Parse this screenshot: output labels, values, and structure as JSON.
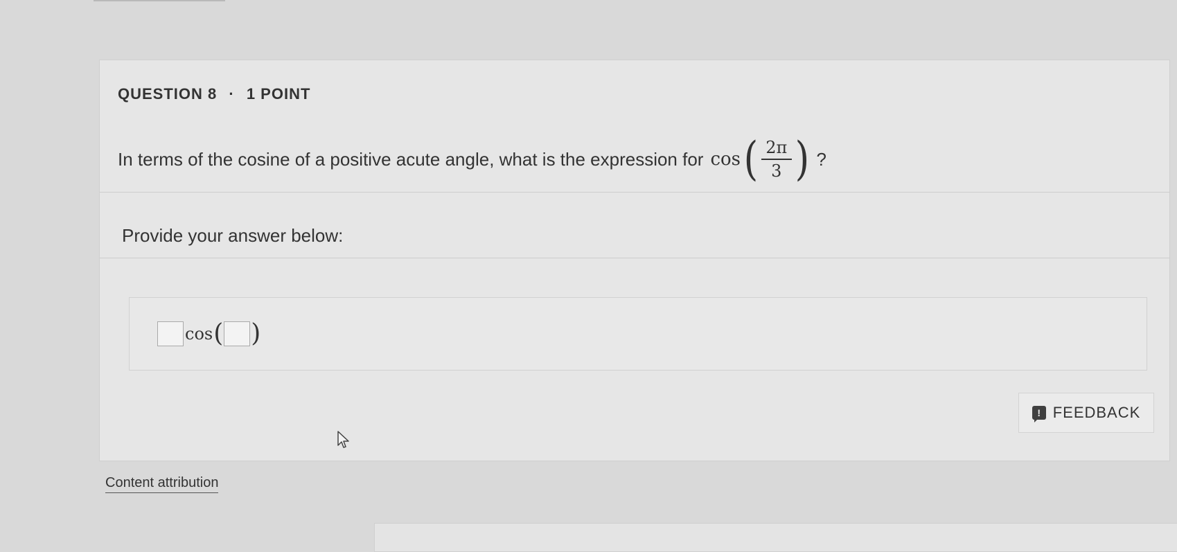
{
  "question": {
    "number_label": "QUESTION 8",
    "separator": "·",
    "points_label": "1 POINT",
    "prompt_text": "In terms of the cosine of a positive acute angle, what is the expression for",
    "math_function": "cos",
    "fraction_numerator": "2π",
    "fraction_denominator": "3",
    "math_open_paren": "(",
    "math_close_paren": ")",
    "question_mark": "?"
  },
  "answer": {
    "instruction": "Provide your answer below:",
    "template_function": "cos",
    "template_open_paren": "(",
    "template_close_paren": ")",
    "coefficient_value": "",
    "angle_value": ""
  },
  "feedback": {
    "label": "FEEDBACK",
    "icon": "feedback-flag-icon"
  },
  "footer": {
    "attribution_link": "Content attribution"
  }
}
